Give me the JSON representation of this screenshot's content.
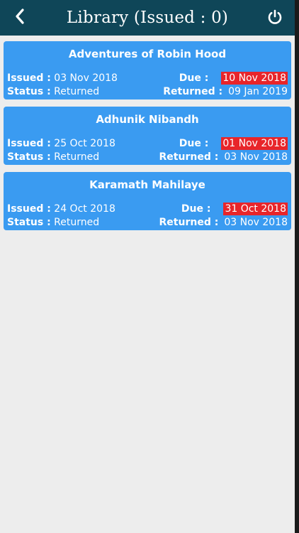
{
  "header": {
    "title": "Library (Issued : 0)",
    "back_icon": "chevron-left-icon",
    "power_icon": "power-icon"
  },
  "labels": {
    "issued": "Issued :",
    "status": "Status :",
    "due": "Due :",
    "returned": "Returned :"
  },
  "colors": {
    "header_bg": "#0f4658",
    "card_bg": "#3a9bf1",
    "due_highlight": "#e8252a",
    "page_bg": "#ededed"
  },
  "books": [
    {
      "title": "Adventures of Robin Hood",
      "issued": "03 Nov 2018",
      "status": "Returned",
      "due": "10 Nov 2018",
      "returned": "09 Jan 2019"
    },
    {
      "title": "Adhunik Nibandh",
      "issued": "25 Oct 2018",
      "status": "Returned",
      "due": "01 Nov 2018",
      "returned": "03 Nov 2018"
    },
    {
      "title": "Karamath Mahilaye",
      "issued": "24 Oct 2018",
      "status": "Returned",
      "due": "31 Oct 2018",
      "returned": "03 Nov 2018"
    }
  ]
}
